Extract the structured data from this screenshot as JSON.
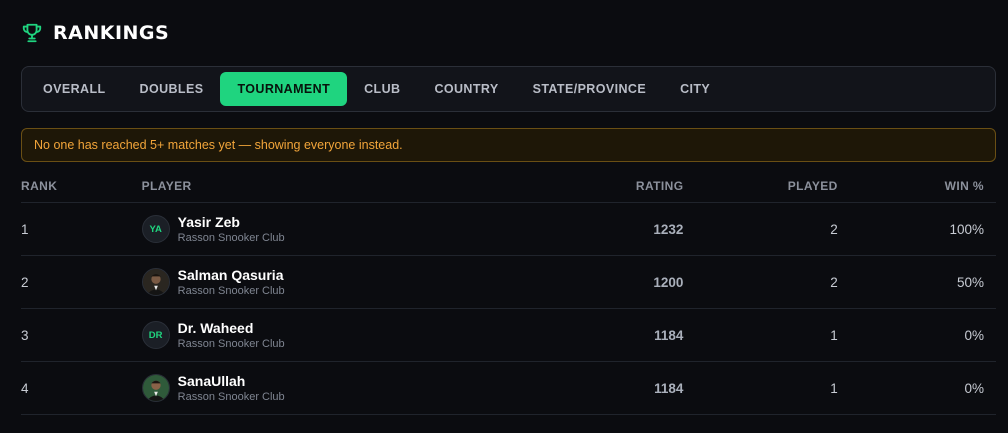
{
  "header": {
    "title": "RANKINGS",
    "icon": "trophy-icon",
    "accent": "#1fd47f"
  },
  "tabs": [
    {
      "label": "OVERALL",
      "active": false
    },
    {
      "label": "DOUBLES",
      "active": false
    },
    {
      "label": "TOURNAMENT",
      "active": true
    },
    {
      "label": "CLUB",
      "active": false
    },
    {
      "label": "COUNTRY",
      "active": false
    },
    {
      "label": "STATE/PROVINCE",
      "active": false
    },
    {
      "label": "CITY",
      "active": false
    }
  ],
  "notice": "No one has reached 5+ matches yet — showing everyone instead.",
  "table": {
    "columns": {
      "rank": "RANK",
      "player": "PLAYER",
      "rating": "RATING",
      "played": "PLAYED",
      "win": "WIN %"
    },
    "rows": [
      {
        "rank": "1",
        "name": "Yasir Zeb",
        "club": "Rasson Snooker Club",
        "avatar": "YA",
        "avatar_type": "initials",
        "rating": "1232",
        "played": "2",
        "win": "100%"
      },
      {
        "rank": "2",
        "name": "Salman Qasuria",
        "club": "Rasson Snooker Club",
        "avatar": "",
        "avatar_type": "photo",
        "rating": "1200",
        "played": "2",
        "win": "50%"
      },
      {
        "rank": "3",
        "name": "Dr. Waheed",
        "club": "Rasson Snooker Club",
        "avatar": "DR",
        "avatar_type": "initials",
        "rating": "1184",
        "played": "1",
        "win": "0%"
      },
      {
        "rank": "4",
        "name": "SanaUllah",
        "club": "Rasson Snooker Club",
        "avatar": "",
        "avatar_type": "photo",
        "rating": "1184",
        "played": "1",
        "win": "0%"
      }
    ]
  }
}
